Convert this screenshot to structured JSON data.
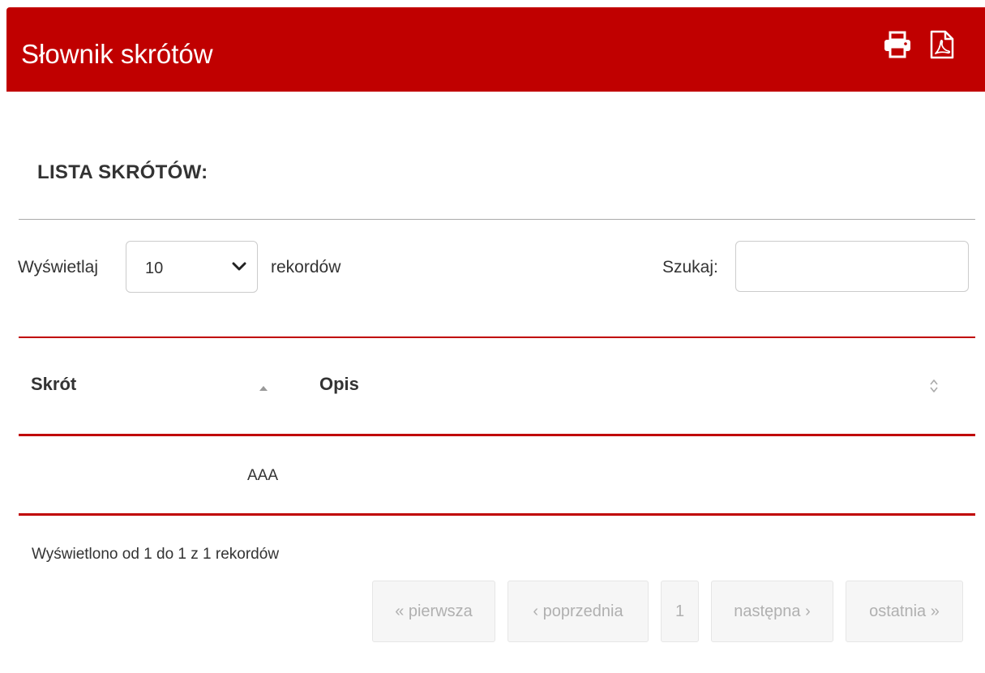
{
  "header": {
    "title": "Słownik skrótów",
    "print_icon": "print-icon",
    "pdf_icon": "file-pdf-icon",
    "background": "#c00000"
  },
  "section": {
    "title": "LISTA SKRÓTÓW:"
  },
  "controls": {
    "show_label": "Wyświetlaj",
    "length_value": "10",
    "records_label": "rekordów",
    "search_label": "Szukaj:",
    "search_value": ""
  },
  "table": {
    "columns": [
      {
        "label": "Skrót",
        "sort": "ascending"
      },
      {
        "label": "Opis",
        "sort": "none"
      }
    ],
    "rows": [
      {
        "skrot": "AAA",
        "opis": ""
      }
    ]
  },
  "footer": {
    "info": "Wyświetlono od 1 do 1 z 1 rekordów",
    "pagination": {
      "first": "« pierwsza",
      "previous": "‹ poprzednia",
      "current": "1",
      "next": "następna ›",
      "last": "ostatnia »"
    }
  }
}
